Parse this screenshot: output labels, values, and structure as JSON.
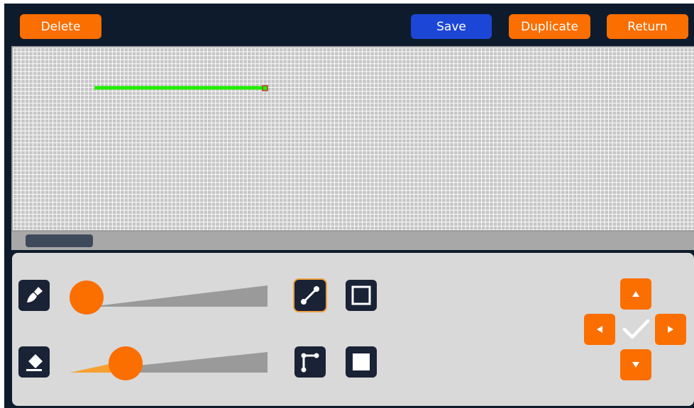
{
  "toolbar": {
    "delete_label": "Delete",
    "save_label": "Save",
    "duplicate_label": "Duplicate",
    "return_label": "Return"
  },
  "colors": {
    "accent_orange": "#fb6e00",
    "save_blue": "#1c47d6",
    "background_navy": "#0e1b2c",
    "drawn_line_green": "#22ee00"
  },
  "tools": {
    "brush_icon": "brush-icon",
    "eraser_icon": "eraser-icon",
    "line_tool_icon": "line-icon",
    "polyline_tool_icon": "polyline-icon",
    "rect_outline_icon": "rectangle-outline-icon",
    "rect_filled_icon": "rectangle-filled-icon",
    "selected_tool": "line",
    "brush_size_level": 0.0,
    "eraser_size_level": 0.28
  },
  "navigation": {
    "up": "arrow-up-icon",
    "down": "arrow-down-icon",
    "left": "arrow-left-icon",
    "right": "arrow-right-icon",
    "confirm": "check-icon"
  }
}
